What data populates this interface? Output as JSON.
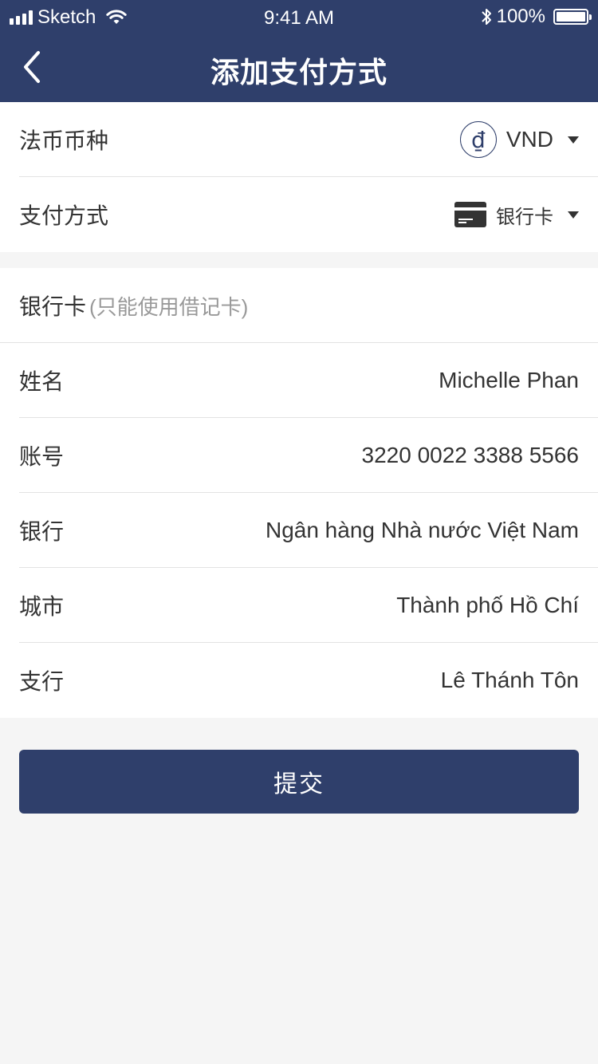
{
  "status_bar": {
    "carrier": "Sketch",
    "time": "9:41 AM",
    "battery": "100%"
  },
  "nav": {
    "title": "添加支付方式"
  },
  "settings": {
    "currency_label": "法币币种",
    "currency_symbol": "₫",
    "currency_value": "VND",
    "payment_label": "支付方式",
    "payment_value": "银行卡"
  },
  "card": {
    "heading": "银行卡",
    "note": "(只能使用借记卡)",
    "fields": [
      {
        "label": "姓名",
        "value": "Michelle Phan"
      },
      {
        "label": "账号",
        "value": "3220 0022 3388 5566"
      },
      {
        "label": "银行",
        "value": "Ngân hàng Nhà nước Việt Nam"
      },
      {
        "label": "城市",
        "value": "Thành phố Hồ Chí"
      },
      {
        "label": "支行",
        "value": "Lê Thánh Tôn"
      }
    ]
  },
  "actions": {
    "submit_label": "提交"
  },
  "colors": {
    "primary": "#2f3f6b",
    "background": "#f5f5f5",
    "divider": "#e3e3e3",
    "hint_text": "#999999"
  },
  "icons": [
    "signal-icon",
    "wifi-icon",
    "bluetooth-icon",
    "battery-icon",
    "back-icon",
    "currency-dong-icon",
    "caret-down-icon",
    "bank-card-icon"
  ]
}
